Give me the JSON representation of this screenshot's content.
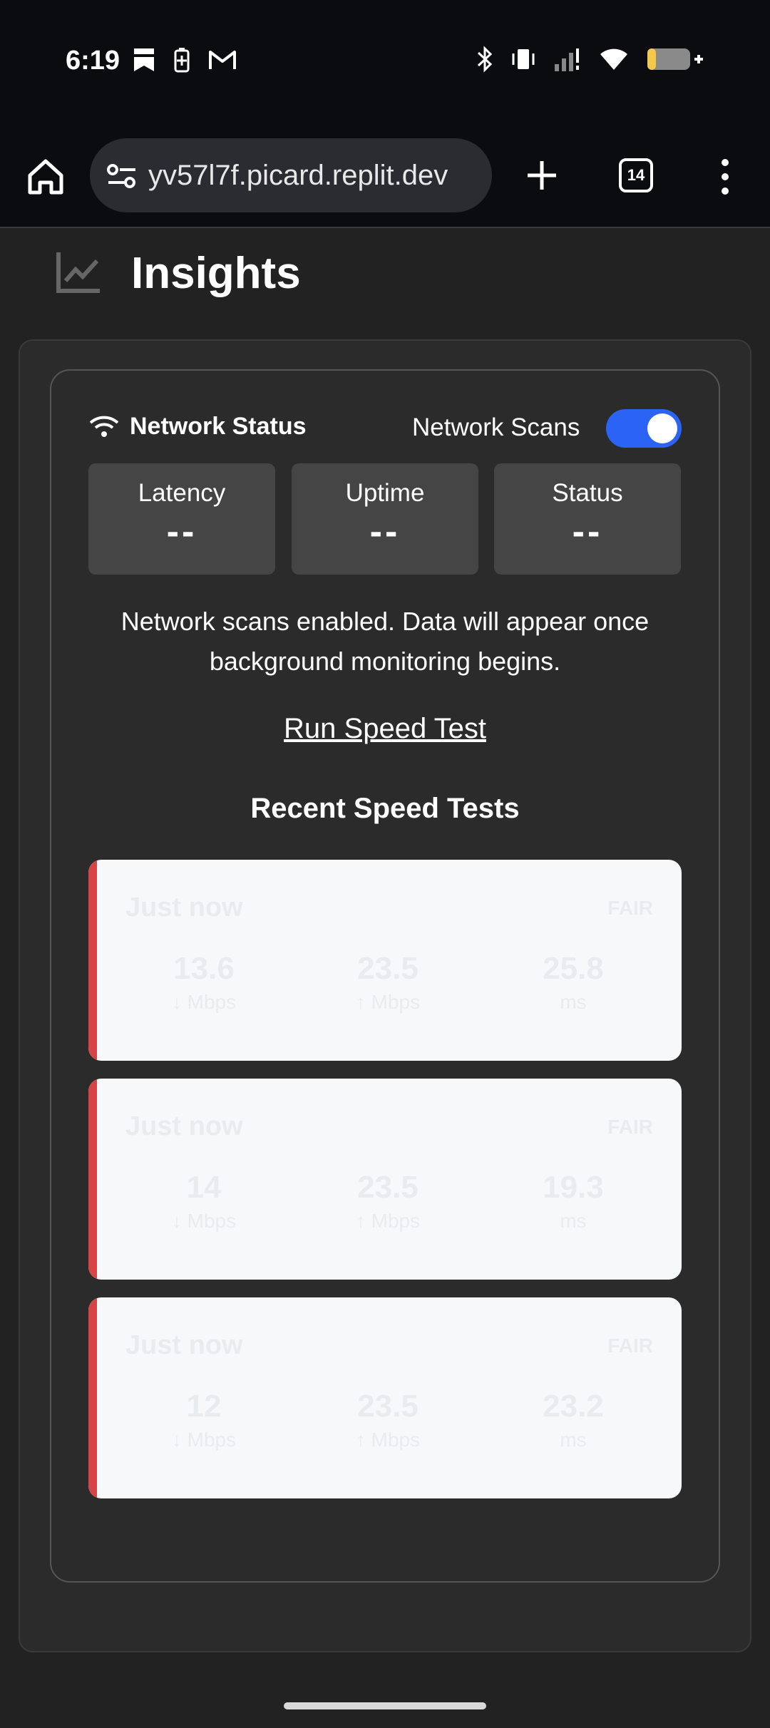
{
  "status_bar": {
    "time": "6:19",
    "left_icons": [
      "bookmark-icon",
      "battery-saver-icon",
      "gmail-icon"
    ],
    "right_icons": [
      "bluetooth-icon",
      "vibrate-icon",
      "signal-icon",
      "wifi-icon",
      "battery-icon"
    ]
  },
  "browser": {
    "url": "yv57l7f.picard.replit.dev",
    "tab_count": "14"
  },
  "page": {
    "title": "Insights"
  },
  "network_status": {
    "title": "Network Status",
    "scan_toggle_label": "Network Scans",
    "scan_toggle_on": true,
    "metrics": [
      {
        "label": "Latency",
        "value": "--"
      },
      {
        "label": "Uptime",
        "value": "--"
      },
      {
        "label": "Status",
        "value": "--"
      }
    ],
    "info": "Network scans enabled. Data will appear once background monitoring begins.",
    "run_test_label": "Run Speed Test"
  },
  "recent_tests": {
    "title": "Recent Speed Tests",
    "items": [
      {
        "time": "Just now",
        "rating": "FAIR",
        "download": "13.6",
        "download_unit": "↓ Mbps",
        "upload": "23.5",
        "upload_unit": "↑ Mbps",
        "ping": "25.8",
        "ping_unit": "ms"
      },
      {
        "time": "Just now",
        "rating": "FAIR",
        "download": "14",
        "download_unit": "↓ Mbps",
        "upload": "23.5",
        "upload_unit": "↑ Mbps",
        "ping": "19.3",
        "ping_unit": "ms"
      },
      {
        "time": "Just now",
        "rating": "FAIR",
        "download": "12",
        "download_unit": "↓ Mbps",
        "upload": "23.5",
        "upload_unit": "↑ Mbps",
        "ping": "23.2",
        "ping_unit": "ms"
      }
    ]
  },
  "colors": {
    "accent": "#2b63f5",
    "card_stripe": "#d74446"
  }
}
